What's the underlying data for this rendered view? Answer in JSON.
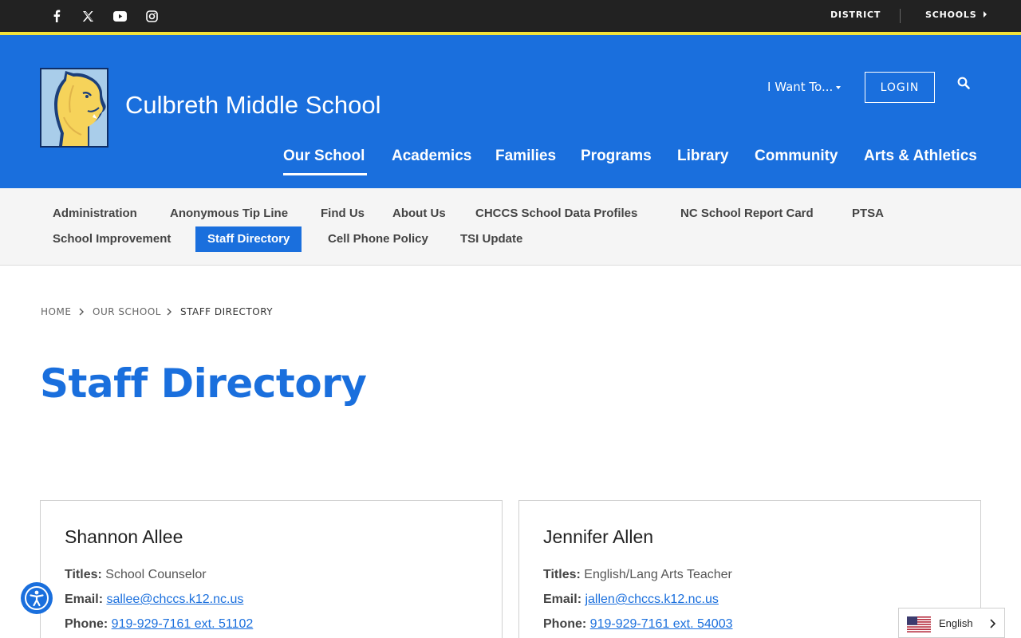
{
  "topbar": {
    "social": [
      {
        "icon": "facebook-icon"
      },
      {
        "icon": "x-twitter-icon"
      },
      {
        "icon": "youtube-icon"
      },
      {
        "icon": "instagram-icon"
      }
    ],
    "district_label": "DISTRICT",
    "schools_label": "SCHOOLS"
  },
  "header": {
    "school_name": "Culbreth Middle School",
    "i_want_to_label": "I Want To...",
    "login_label": "LOGIN",
    "nav": [
      "Our School",
      "Academics",
      "Families",
      "Programs",
      "Library",
      "Community",
      "Arts & Athletics"
    ],
    "active_nav": "Our School"
  },
  "subnav": {
    "items": [
      "Administration",
      "Anonymous Tip Line",
      "Find Us",
      "About Us",
      "CHCCS School Data Profiles",
      "NC School Report Card",
      "PTSA",
      "School Improvement",
      "Staff Directory",
      "Cell Phone Policy",
      "TSI Update"
    ],
    "active": "Staff Directory"
  },
  "breadcrumb": {
    "home": "HOME",
    "section": "OUR SCHOOL",
    "current": "STAFF DIRECTORY"
  },
  "page": {
    "title": "Staff Directory"
  },
  "labels": {
    "titles": "Titles:",
    "email": "Email:",
    "phone": "Phone:"
  },
  "staff": [
    {
      "name": "Shannon Allee",
      "title": "School Counselor",
      "email": "sallee@chccs.k12.nc.us",
      "phone": "919-929-7161 ext. 51102"
    },
    {
      "name": "Jennifer Allen",
      "title": "English/Lang Arts Teacher",
      "email": "jallen@chccs.k12.nc.us",
      "phone": "919-929-7161 ext. 54003"
    }
  ],
  "language": {
    "selected": "English"
  },
  "colors": {
    "brand_blue": "#1a6fdd",
    "topbar": "#222222",
    "accent_yellow": "#f2e33a"
  }
}
